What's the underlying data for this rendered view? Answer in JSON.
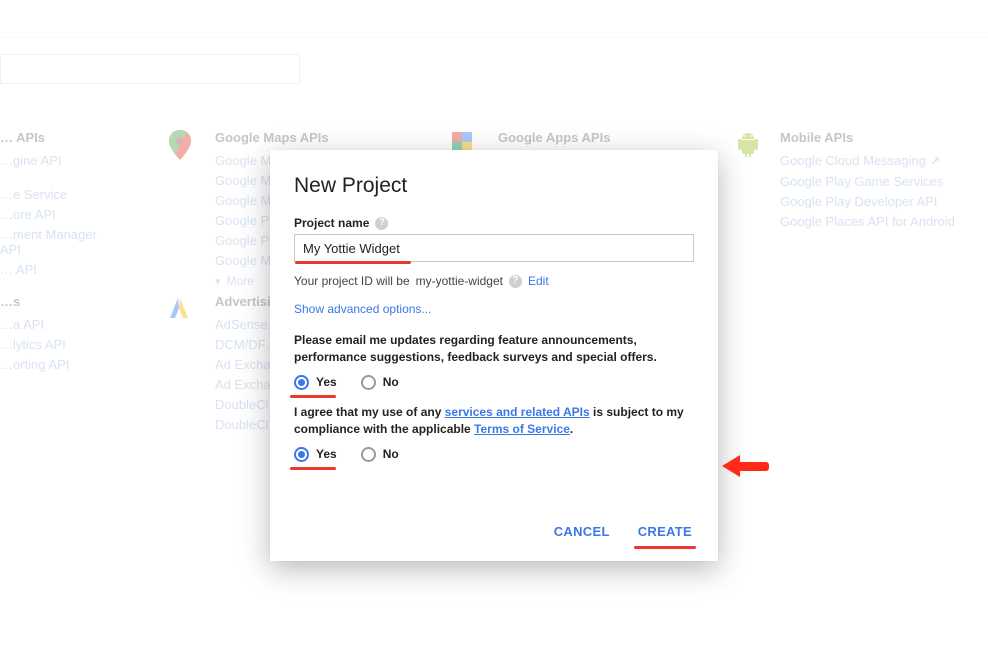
{
  "search": {
    "placeholder": ""
  },
  "background": {
    "col_left": {
      "header": "… APIs",
      "links": [
        "…gine API",
        "",
        "…e Service",
        "…ore API",
        "…ment Manager API",
        "… API"
      ]
    },
    "maps": {
      "header": "Google Maps APIs",
      "links": [
        "Google M…",
        "Google M…",
        "Google M…",
        "Google P…",
        "Google P…",
        "Google M…"
      ],
      "more": "More"
    },
    "col_left2": {
      "header": "…s",
      "links": [
        "…a API",
        "…lytics API",
        "…orting API"
      ]
    },
    "advertising": {
      "header": "Advertisi…",
      "links": [
        "AdSense…",
        "DCM/DF…",
        "Ad Excha…",
        "Ad Excha…",
        "DoubleCl…",
        "DoubleCl…"
      ]
    },
    "apps": {
      "header": "Google Apps APIs"
    },
    "mobile": {
      "header": "Mobile APIs",
      "links": [
        "Google Cloud Messaging",
        "Google Play Game Services",
        "Google Play Developer API",
        "Google Places API for Android"
      ]
    }
  },
  "modal": {
    "title": "New Project",
    "name_label": "Project name",
    "name_value": "My Yottie Widget",
    "projid_prefix": "Your project ID will be",
    "projid_value": "my-yottie-widget",
    "edit_label": "Edit",
    "advanced_label": "Show advanced options...",
    "email_question": "Please email me updates regarding feature announcements, performance suggestions, feedback surveys and special offers.",
    "yes": "Yes",
    "no": "No",
    "tos_prefix": "I agree that my use of any ",
    "tos_link1": "services and related APIs",
    "tos_mid": " is subject to my compliance with the applicable ",
    "tos_link2": "Terms of Service",
    "tos_suffix": ".",
    "cancel": "CANCEL",
    "create": "CREATE"
  },
  "icons": {
    "maps": "map-pin-icon",
    "apps": "google-apps-icon",
    "mobile": "android-icon",
    "advertising": "adwords-icon",
    "external": "external-link-icon"
  }
}
